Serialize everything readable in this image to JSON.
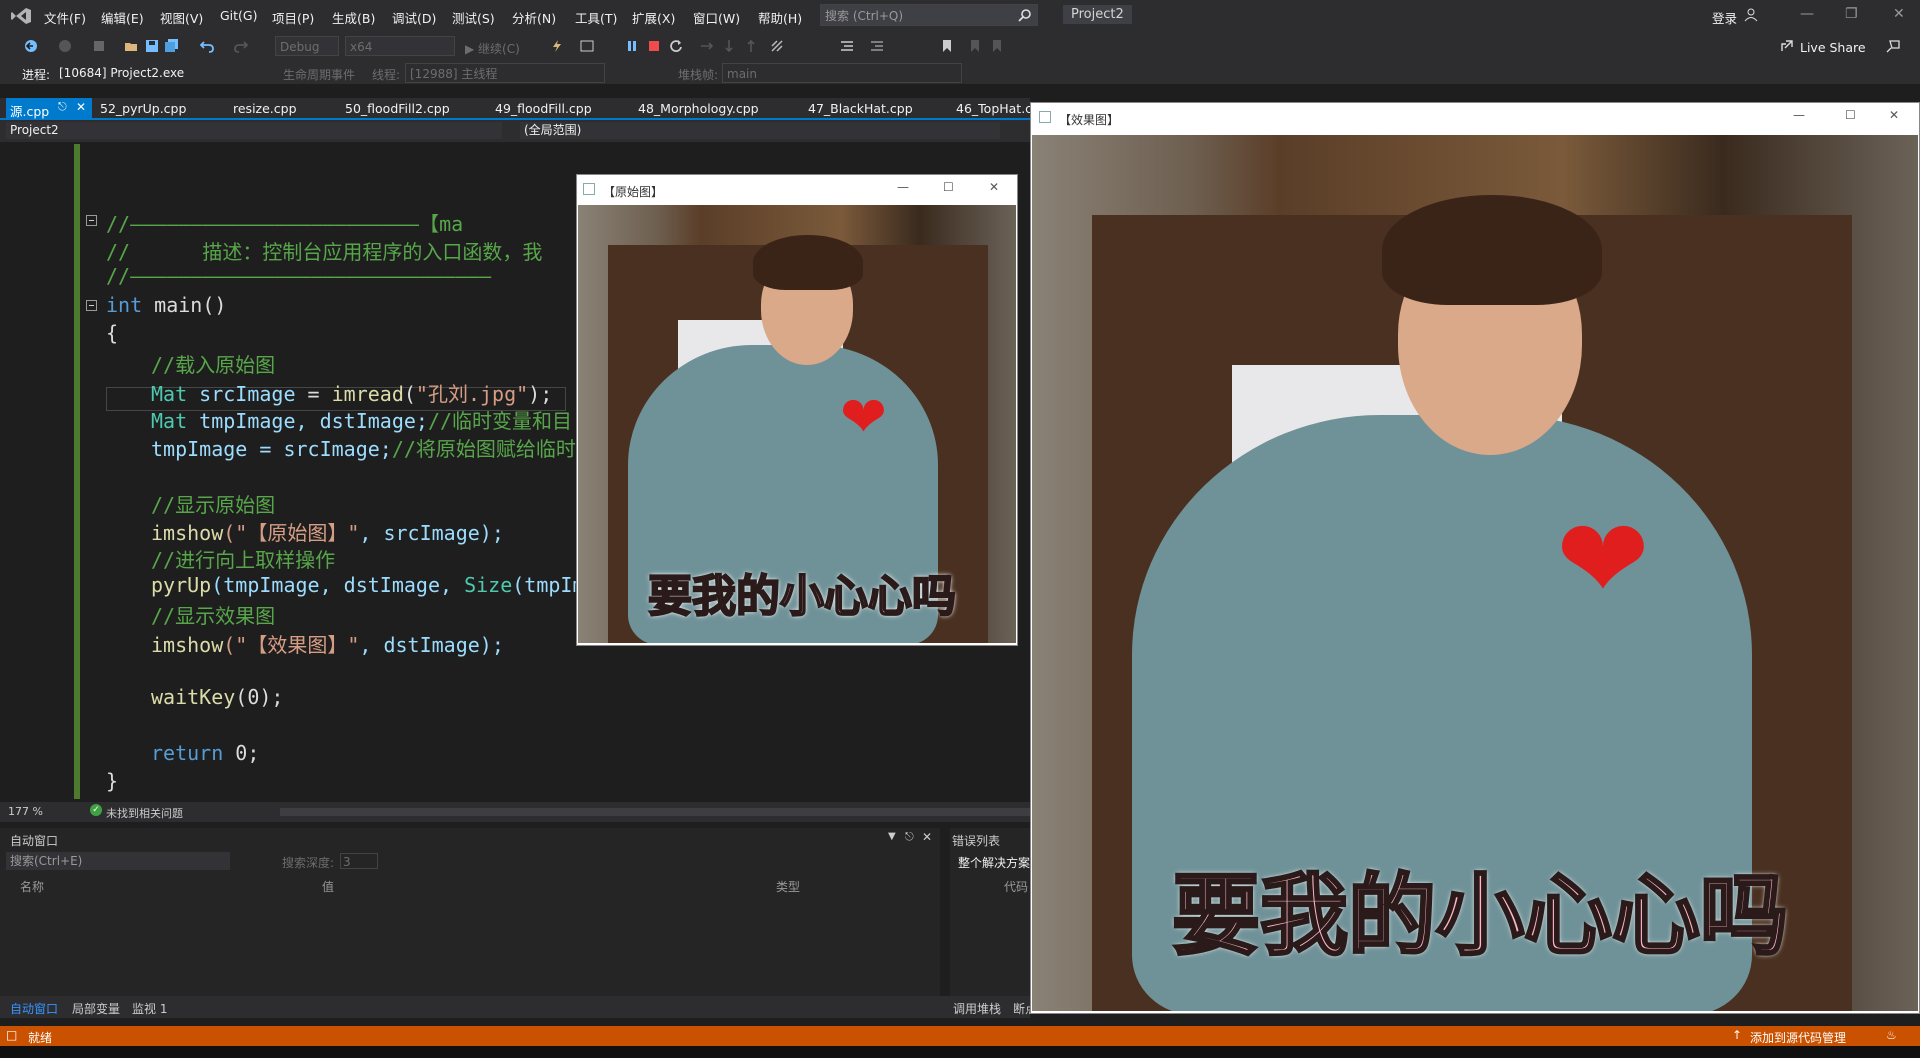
{
  "menubar": {
    "items": [
      "文件(F)",
      "编辑(E)",
      "视图(V)",
      "Git(G)",
      "项目(P)",
      "生成(B)",
      "调试(D)",
      "测试(S)",
      "分析(N)",
      "工具(T)",
      "扩展(X)",
      "窗口(W)",
      "帮助(H)"
    ],
    "search_placeholder": "搜索 (Ctrl+Q)",
    "project_title": "Project2",
    "login": "登录"
  },
  "toolbar": {
    "config": "Debug",
    "platform": "x64",
    "continue": "继续(C)",
    "live_share": "Live Share"
  },
  "debugbar": {
    "process_label": "进程:",
    "process_value": "[10684] Project2.exe",
    "lifecycle": "生命周期事件",
    "thread_label": "线程:",
    "thread_value": "[12988] 主线程",
    "stackframe_label": "堆栈帧:",
    "stackframe_value": "main"
  },
  "tabs": [
    "源.cpp",
    "52_pyrUp.cpp",
    "resize.cpp",
    "50_floodFill2.cpp",
    "49_floodFill.cpp",
    "48_Morphology.cpp",
    "47_BlackHat.cpp",
    "46_TopHat.c"
  ],
  "navbar": {
    "project": "Project2",
    "scope": "(全局范围)"
  },
  "code": {
    "l1": "//————————————————————————【ma",
    "l2": "//      描述：控制台应用程序的入口函数，我",
    "l3": "//——————————————————————————————",
    "l4_kw": "int",
    "l4_rest": " main()",
    "l5": "{",
    "l6": "//载入原始图",
    "l7_type": "Mat",
    "l7_var": " srcImage",
    "l7_eq": " = ",
    "l7_fn": "imread",
    "l7_p": "(",
    "l7_str": "\"孔刘.jpg\"",
    "l7_end": ");  /",
    "l8_type": "Mat",
    "l8_rest": " tmpImage, dstImage;",
    "l8_comment": "//临时变量和目",
    "l9_rest": "tmpImage = srcImage;",
    "l9_comment": "//将原始图赋给临时",
    "l10": "//显示原始图",
    "l11_fn": "imshow",
    "l11_str": "(\"【原始图】\"",
    "l11_rest": ", srcImage);",
    "l12": "//进行向上取样操作",
    "l13_fn": "pyrUp",
    "l13_rest": "(tmpImage, dstImage, ",
    "l13_type": "Size",
    "l13_tail": "(tmpIma",
    "l14": "//显示效果图",
    "l15_fn": "imshow",
    "l15_str": "(\"【效果图】\"",
    "l15_rest": ", dstImage);",
    "l16_fn": "waitKey",
    "l16_rest": "(0);",
    "l17_kw": "return",
    "l17_rest": " 0;",
    "l18": "}"
  },
  "editor_status": {
    "zoom": "177 %",
    "issues": "未找到相关问题"
  },
  "autos": {
    "title": "自动窗口",
    "search_placeholder": "搜索(Ctrl+E)",
    "depth_label": "搜索深度:",
    "depth_value": "3",
    "col_name": "名称",
    "col_value": "值",
    "col_type": "类型"
  },
  "errors": {
    "title": "错误列表",
    "scope": "整个解决方案",
    "col_code": "代码"
  },
  "bottom_tabs": [
    "自动窗口",
    "局部变量",
    "监视 1"
  ],
  "bottom_tabs_right": [
    "调用堆栈",
    "断点"
  ],
  "statusbar": {
    "ready": "就绪",
    "source_control": "添加到源代码管理"
  },
  "window_original": {
    "title": "【原始图】",
    "caption": "要我的小心心吗"
  },
  "window_result": {
    "title": "【效果图】",
    "caption": "要我的小心心吗"
  },
  "colors": {
    "accent": "#007acc",
    "statusbar": "#ca5100",
    "heart": "#e01e1e"
  }
}
